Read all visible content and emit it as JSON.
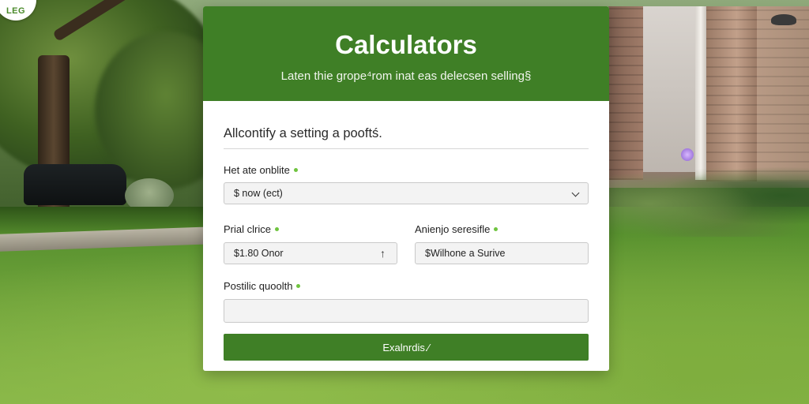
{
  "logo": {
    "text": "LEG"
  },
  "header": {
    "title": "Calculators",
    "subtitle": "Laten thie grope⁴rom inat eas delecsen selling§"
  },
  "section": {
    "title": "Allcontify a setting a pooftś."
  },
  "fields": {
    "first": {
      "label": "Het ate onblite",
      "value": "$ now (ect)"
    },
    "price": {
      "label": "Prial clrice",
      "value": "$1.80 Onor"
    },
    "service": {
      "label": "Anienjo seresifle",
      "value": "$Wilhone a Surive"
    },
    "quote": {
      "label": "Postilic quoolth",
      "value": ""
    }
  },
  "submit": {
    "label": "Exalnrdis.∕"
  },
  "colors": {
    "brand_green": "#3f7f26",
    "required_dot": "#6fc43f",
    "field_bg": "#f3f3f3"
  },
  "icons": {
    "select": "chevron-down-icon",
    "stepper": "up-arrow-icon"
  }
}
